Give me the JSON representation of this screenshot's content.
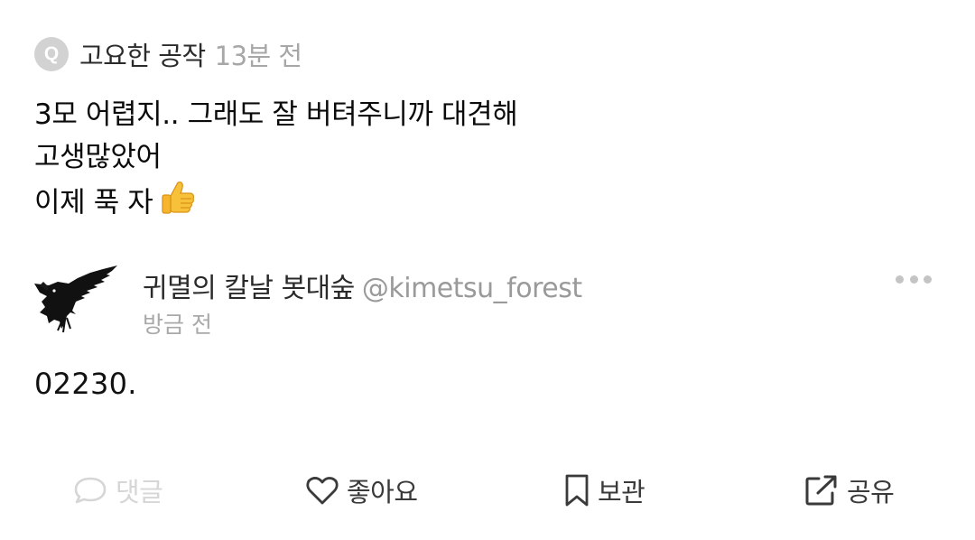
{
  "quote": {
    "badge": "Q",
    "author": "고요한 공작",
    "time": "13분 전",
    "lines": [
      "3모 어렵지.. 그래도 잘 버텨주니까 대견해",
      "고생많았어",
      "이제 푹 자"
    ],
    "emoji_icon": "thumbs-up-icon"
  },
  "post": {
    "name": "귀멸의 칼날 봇대숲",
    "handle": "@kimetsu_forest",
    "time": "방금 전",
    "body": "02230.",
    "avatar_icon": "crow-avatar"
  },
  "actions": {
    "comment": "댓글",
    "like": "좋아요",
    "save": "보관",
    "share": "공유"
  },
  "colors": {
    "text": "#111111",
    "muted": "#a7a7a7",
    "disabled": "#d6d6d6",
    "icon": "#3a3a3a"
  }
}
